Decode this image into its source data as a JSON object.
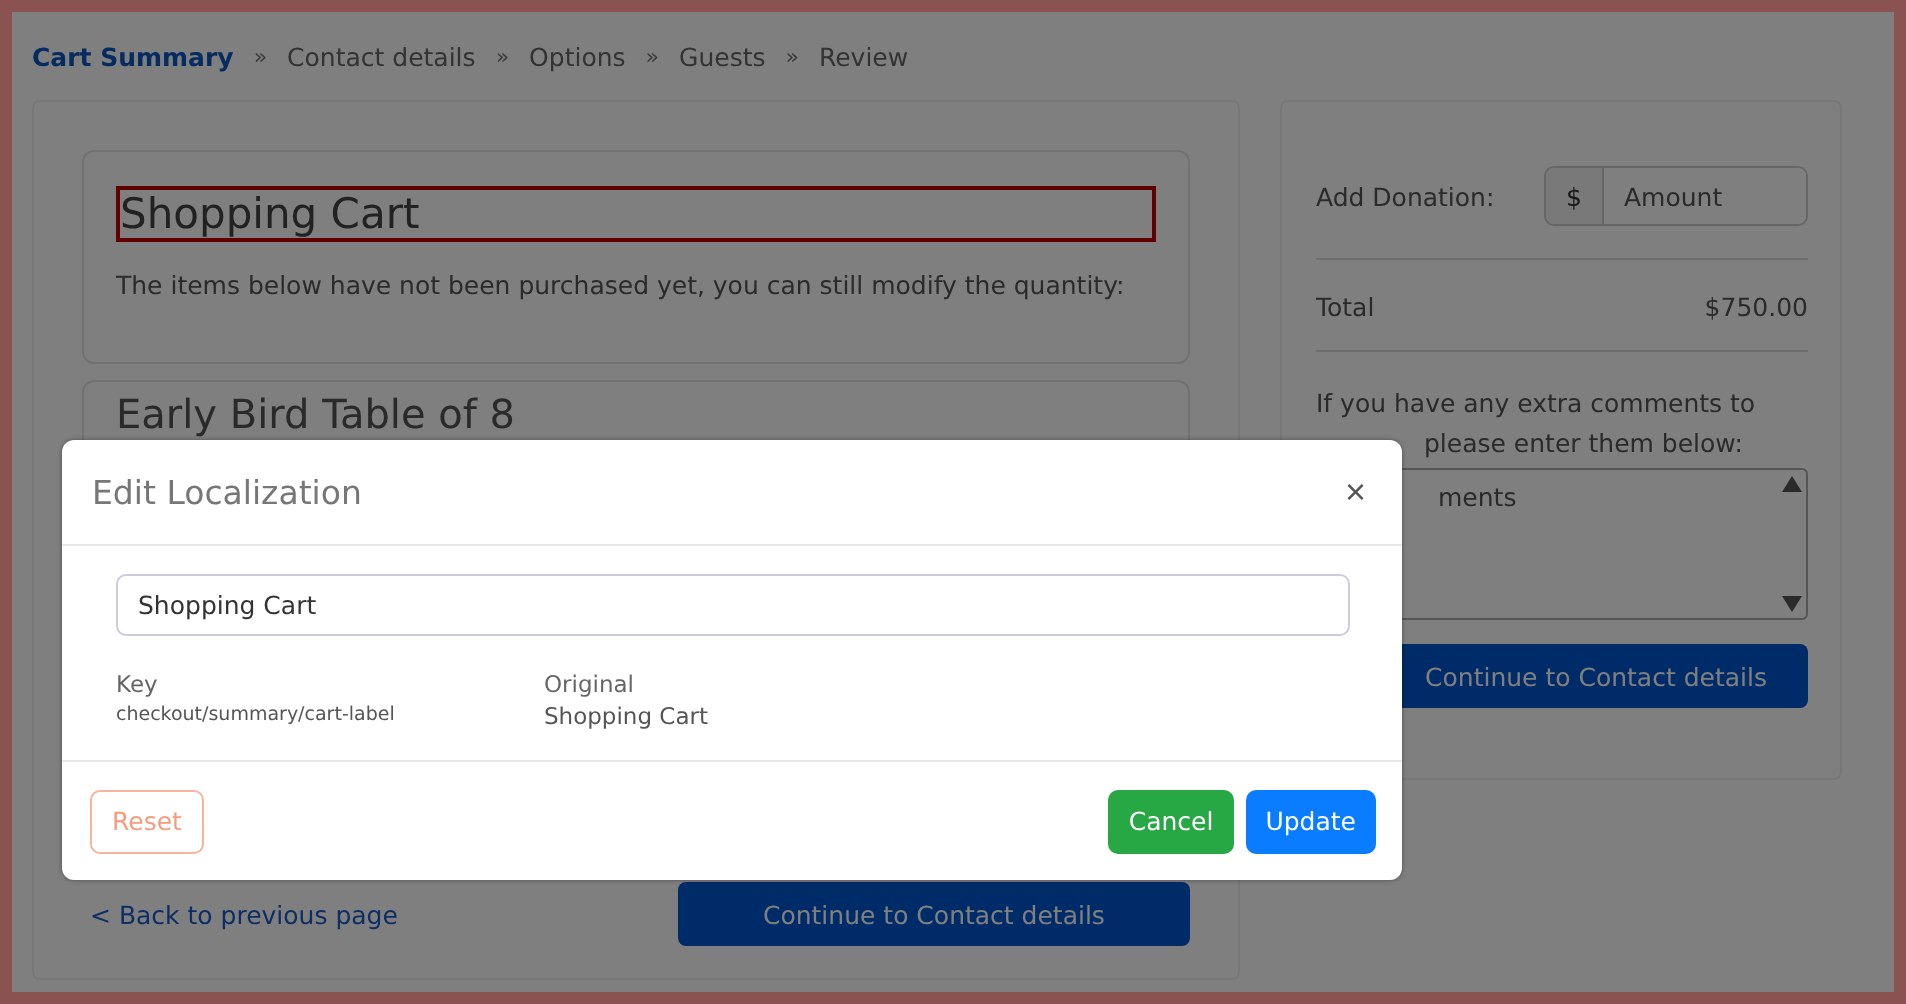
{
  "breadcrumb": [
    {
      "label": "Cart Summary",
      "selected": true
    },
    {
      "label": "Contact details",
      "selected": false
    },
    {
      "label": "Options",
      "selected": false
    },
    {
      "label": "Guests",
      "selected": false
    },
    {
      "label": "Review",
      "selected": false
    }
  ],
  "breadcrumb_separator": "»",
  "cart": {
    "title": "Shopping Cart",
    "description": "The items below have not been purchased yet, you can still modify the quantity:",
    "item_title": "Early Bird Table of 8"
  },
  "back_link": "< Back to previous page",
  "continue_button": "Continue to Contact details",
  "sidebar": {
    "donation_label": "Add Donation:",
    "currency": "$",
    "amount_placeholder": "Amount",
    "total_label": "Total",
    "total_value": "$750.00",
    "comments_line_1": "If you have any extra comments to",
    "comments_line_2": "please enter them below:",
    "comments_placeholder": "ments",
    "continue_button": "Continue to Contact details"
  },
  "modal": {
    "title": "Edit Localization",
    "close": "×",
    "value": "Shopping Cart",
    "key_label": "Key",
    "key_value": "checkout/summary/cart-label",
    "original_label": "Original",
    "original_value": "Shopping Cart",
    "reset": "Reset",
    "cancel": "Cancel",
    "update": "Update"
  }
}
